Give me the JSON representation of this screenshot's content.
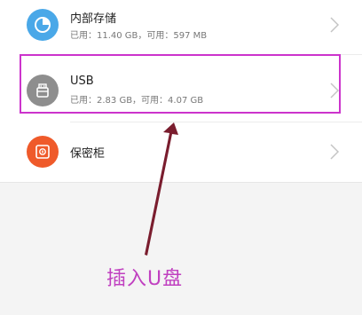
{
  "storage_list": {
    "items": [
      {
        "name": "内部存储",
        "detail": "已用：11.40 GB，可用：597 MB",
        "icon": "pie-chart-icon",
        "icon_color": "#4aa8e8"
      },
      {
        "name": "USB",
        "detail": "已用：2.83 GB，可用：4.07 GB",
        "icon": "usb-drive-icon",
        "icon_color": "#8e8e8e"
      },
      {
        "name": "保密柜",
        "icon": "safe-icon",
        "icon_color": "#ef5a2a"
      }
    ]
  },
  "annotation": {
    "label": "插入U盘",
    "highlight_color": "#cc33cc",
    "arrow_color": "#7a1d2e"
  }
}
